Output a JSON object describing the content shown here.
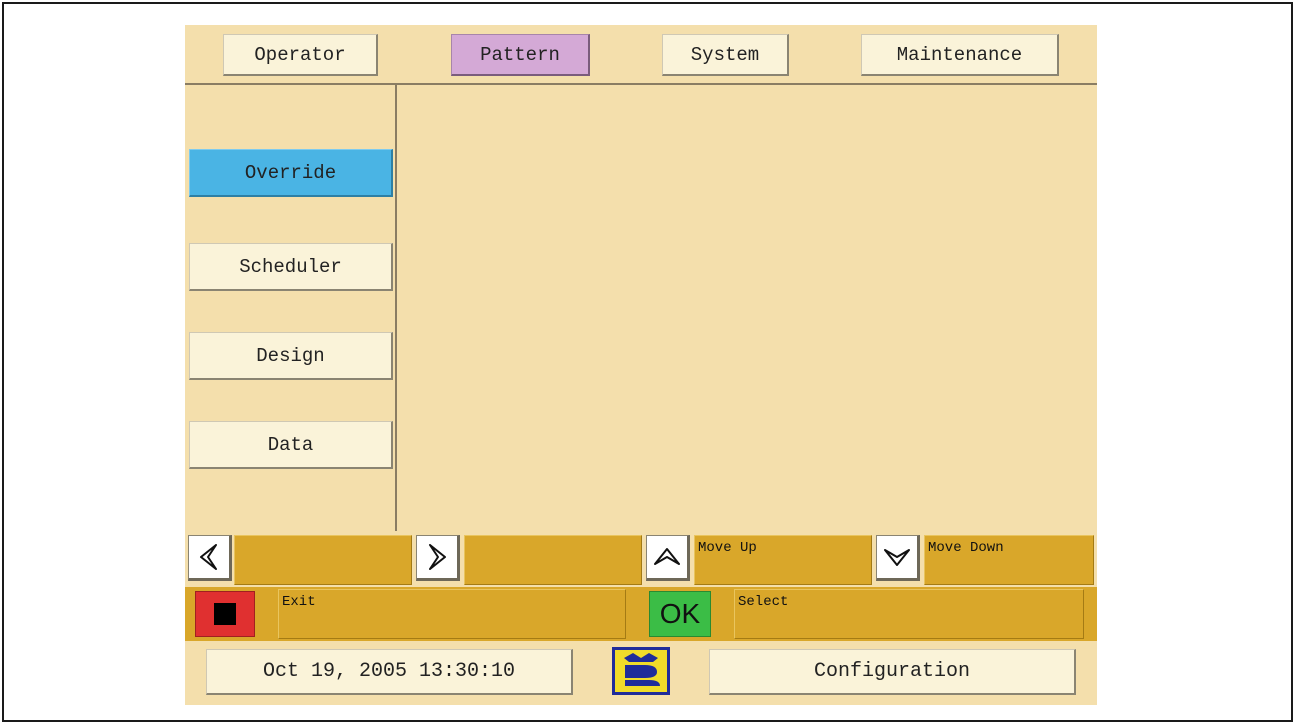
{
  "tabs": {
    "operator": "Operator",
    "pattern": "Pattern",
    "system": "System",
    "maintenance": "Maintenance"
  },
  "sidebar": {
    "override": "Override",
    "scheduler": "Scheduler",
    "design": "Design",
    "data": "Data"
  },
  "softkeys": {
    "move_up": "Move Up",
    "move_down": "Move Down",
    "exit": "Exit",
    "select": "Select",
    "ok": "OK"
  },
  "footer": {
    "datetime": "Oct 19, 2005 13:30:10",
    "configuration": "Configuration"
  },
  "colors": {
    "screen_bg": "#f4dfac",
    "active_tab": "#d4a9d6",
    "active_side": "#4ab4e4",
    "softkey": "#d9a72a",
    "stop": "#e03030",
    "ok": "#3bbd46"
  },
  "icons": {
    "left": "arrow-left-icon",
    "right": "arrow-right-icon",
    "up": "arrow-up-icon",
    "down": "arrow-down-icon",
    "stop": "stop-icon",
    "logo": "brand-logo-icon"
  }
}
